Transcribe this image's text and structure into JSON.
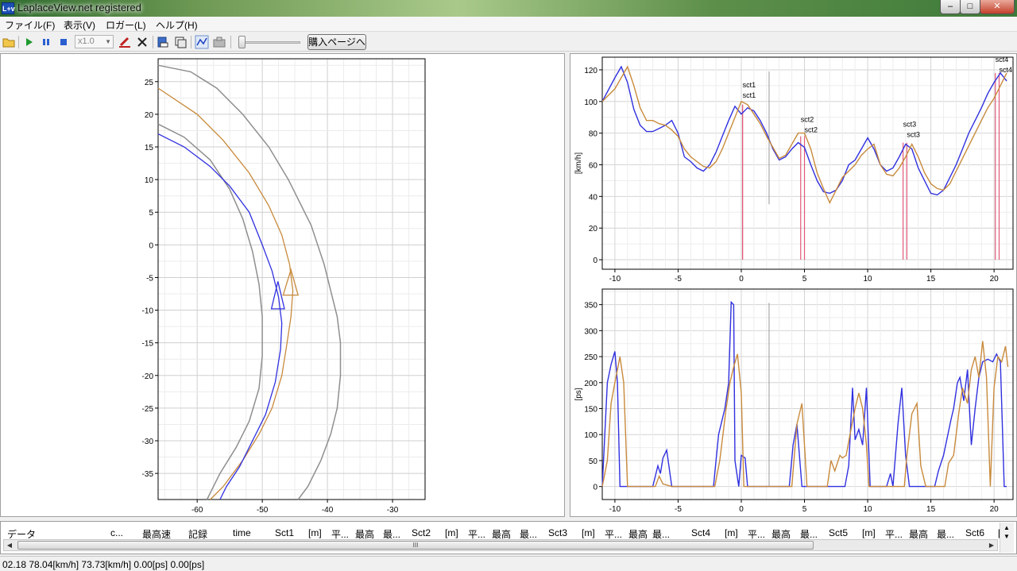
{
  "window": {
    "title": "LaplaceView.net registered",
    "icon_label": "L+v",
    "controls": {
      "minimize": "–",
      "maximize": "□",
      "close": "✕"
    }
  },
  "menu": [
    "ファイル(F)",
    "表示(V)",
    "ロガー(L)",
    "ヘルプ(H)"
  ],
  "toolbar": {
    "speed": "x1.0",
    "buy_button": "購入ページへ"
  },
  "map": {
    "x_ticks": [
      "-60",
      "-50",
      "-40",
      "-30"
    ],
    "y_ticks": [
      "25",
      "20",
      "15",
      "10",
      "5",
      "0",
      "-5",
      "-10",
      "-15",
      "-20",
      "-25",
      "-30",
      "-35"
    ]
  },
  "chart_data": [
    {
      "type": "line",
      "ylabel": "[km/h]",
      "xlim": [
        -11,
        21.5
      ],
      "ylim": [
        -6,
        128
      ],
      "x_ticks": [
        -10,
        -5,
        0,
        5,
        10,
        15,
        20
      ],
      "y_ticks": [
        0,
        20,
        40,
        60,
        80,
        100,
        120
      ],
      "cursor_x": 2.2,
      "series": [
        {
          "color": "#3030e0",
          "x": [
            -11,
            -10,
            -9.5,
            -9,
            -8.5,
            -8,
            -7.5,
            -7,
            -6.5,
            -6,
            -5.5,
            -5,
            -4.5,
            -4,
            -3.5,
            -3,
            -2.5,
            -2,
            -1.5,
            -1,
            -0.5,
            0,
            0.5,
            1,
            1.5,
            2,
            2.5,
            3,
            3.5,
            4,
            4.5,
            5,
            5.5,
            6,
            6.5,
            7,
            7.5,
            8,
            8.5,
            9,
            9.5,
            10,
            10.5,
            11,
            11.5,
            12,
            12.5,
            13,
            13.5,
            14,
            14.5,
            15,
            15.5,
            16,
            16.5,
            17,
            17.5,
            18,
            18.5,
            19,
            19.5,
            20,
            20.5,
            21
          ],
          "values": [
            100,
            115,
            122,
            112,
            95,
            85,
            81,
            81,
            83,
            85,
            88,
            80,
            65,
            62,
            58,
            56,
            60,
            68,
            78,
            88,
            97,
            92,
            96,
            94,
            88,
            80,
            70,
            63,
            65,
            70,
            74,
            71,
            60,
            50,
            43,
            42,
            44,
            50,
            60,
            63,
            70,
            77,
            70,
            60,
            56,
            58,
            65,
            73,
            70,
            58,
            50,
            42,
            41,
            44,
            52,
            60,
            70,
            80,
            88,
            96,
            105,
            112,
            118,
            113
          ]
        },
        {
          "color": "#c88a3c",
          "x": [
            -11,
            -10,
            -9.5,
            -9,
            -8.5,
            -8,
            -7.5,
            -7,
            -6.5,
            -6,
            -5.5,
            -5,
            -4.5,
            -4,
            -3.5,
            -3,
            -2.5,
            -2,
            -1.5,
            -1,
            -0.5,
            0,
            0.5,
            1,
            1.5,
            2,
            2.5,
            3,
            3.5,
            4,
            4.5,
            5,
            5.5,
            6,
            6.5,
            7,
            7.5,
            8,
            8.5,
            9,
            9.5,
            10,
            10.5,
            11,
            11.5,
            12,
            12.5,
            13,
            13.5,
            14,
            14.5,
            15,
            15.5,
            16,
            16.5,
            17,
            17.5,
            18,
            18.5,
            19,
            19.5,
            20,
            20.5,
            21
          ],
          "values": [
            100,
            108,
            115,
            122,
            110,
            96,
            88,
            88,
            86,
            85,
            82,
            78,
            70,
            65,
            62,
            59,
            58,
            62,
            70,
            80,
            90,
            100,
            98,
            92,
            86,
            78,
            71,
            64,
            66,
            73,
            80,
            80,
            70,
            55,
            45,
            36,
            44,
            52,
            56,
            60,
            66,
            70,
            73,
            60,
            54,
            53,
            58,
            65,
            73,
            65,
            55,
            48,
            45,
            44,
            48,
            56,
            64,
            72,
            80,
            88,
            96,
            102,
            110,
            118
          ]
        }
      ],
      "sectors": [
        {
          "label": "sct1",
          "x": [
            0.1,
            0.1
          ]
        },
        {
          "label": "sct2",
          "x": [
            4.7,
            5.0
          ]
        },
        {
          "label": "sct3",
          "x": [
            12.8,
            13.1
          ]
        },
        {
          "label": "sct4",
          "x": [
            20.1,
            20.4
          ]
        }
      ]
    },
    {
      "type": "line",
      "ylabel": "[ps]",
      "xlim": [
        -11,
        21.5
      ],
      "ylim": [
        -25,
        380
      ],
      "x_ticks": [
        -10,
        -5,
        0,
        5,
        10,
        15,
        20
      ],
      "y_ticks": [
        0,
        50,
        100,
        150,
        200,
        250,
        300,
        350
      ],
      "cursor_x": 2.2,
      "series": [
        {
          "color": "#3030e0",
          "x": [
            -11,
            -10.6,
            -10.3,
            -10,
            -9.8,
            -9.6,
            -9.3,
            -8.5,
            -7.5,
            -7,
            -6.6,
            -6.4,
            -6.2,
            -5.9,
            -5.5,
            -4.6,
            -3.5,
            -2.7,
            -2.2,
            -1.8,
            -1.3,
            -1,
            -0.8,
            -0.6,
            -0.5,
            -0.2,
            0,
            0.3,
            0.5,
            1.2,
            2,
            3,
            3.8,
            4.1,
            4.4,
            4.8,
            5,
            5.2,
            5.6,
            6.2,
            6.6,
            7.2,
            7.6,
            8,
            8.2,
            8.5,
            8.8,
            9,
            9.3,
            9.6,
            9.9,
            10.2,
            10.5,
            11,
            11.5,
            11.8,
            12,
            12.4,
            12.7,
            13,
            13.3,
            13.6,
            14,
            14.6,
            15.3,
            15.6,
            16,
            16.3,
            16.6,
            16.8,
            17.1,
            17.3,
            17.6,
            17.9,
            18.2,
            18.5,
            18.8,
            19.1,
            19.5,
            19.9,
            20.2,
            20.5,
            20.8,
            21
          ],
          "values": [
            0,
            200,
            235,
            260,
            200,
            0,
            0,
            0,
            0,
            0,
            40,
            25,
            55,
            70,
            0,
            0,
            0,
            0,
            0,
            100,
            150,
            200,
            355,
            350,
            50,
            0,
            60,
            55,
            0,
            0,
            0,
            0,
            0,
            80,
            120,
            0,
            0,
            0,
            0,
            0,
            0,
            0,
            0,
            0,
            0,
            40,
            190,
            90,
            110,
            80,
            190,
            0,
            0,
            0,
            0,
            25,
            0,
            120,
            190,
            60,
            0,
            0,
            0,
            0,
            0,
            30,
            60,
            95,
            130,
            150,
            200,
            210,
            165,
            225,
            80,
            150,
            210,
            240,
            245,
            240,
            255,
            240,
            0,
            0
          ]
        },
        {
          "color": "#c88a3c",
          "x": [
            -11,
            -10.6,
            -10.3,
            -10,
            -9.6,
            -9.3,
            -9,
            -8.5,
            -7.5,
            -6.8,
            -6.5,
            -6.2,
            -5.5,
            -4.5,
            -3.5,
            -2.6,
            -2.1,
            -1.7,
            -1.2,
            -0.9,
            -0.6,
            -0.3,
            0,
            0.2,
            0.4,
            1.2,
            2,
            3,
            4,
            4.4,
            4.8,
            5.2,
            5.6,
            6.2,
            6.8,
            7.1,
            7.4,
            7.8,
            8,
            8.3,
            8.6,
            9,
            9.3,
            9.6,
            9.9,
            10.1,
            10.5,
            11,
            11.5,
            12,
            12.5,
            12.9,
            13.1,
            13.5,
            13.9,
            14.2,
            14.6,
            15.3,
            15.7,
            16.1,
            16.4,
            16.8,
            17.2,
            17.5,
            17.9,
            18.2,
            18.5,
            18.8,
            19.1,
            19.4,
            19.7,
            20,
            20.3,
            20.6,
            20.9,
            21.1
          ],
          "values": [
            0,
            50,
            160,
            200,
            250,
            200,
            0,
            0,
            0,
            0,
            20,
            5,
            0,
            0,
            0,
            0,
            0,
            50,
            150,
            200,
            230,
            255,
            180,
            0,
            0,
            0,
            0,
            0,
            0,
            120,
            160,
            0,
            0,
            0,
            0,
            50,
            30,
            60,
            55,
            60,
            100,
            150,
            180,
            150,
            80,
            0,
            0,
            0,
            0,
            0,
            0,
            0,
            60,
            140,
            160,
            40,
            0,
            0,
            0,
            0,
            45,
            60,
            140,
            190,
            160,
            225,
            250,
            210,
            280,
            210,
            0,
            190,
            250,
            240,
            270,
            230
          ]
        }
      ]
    }
  ],
  "table": {
    "columns": [
      "データ",
      "c...",
      "最高速",
      "記録",
      "time",
      "Sct1",
      "[m]",
      "平...",
      "最高",
      "最...",
      "Sct2",
      "[m]",
      "平...",
      "最高",
      "最...",
      "Sct3",
      "[m]",
      "平...",
      "最高",
      "最...",
      "Sct4",
      "[m]",
      "平...",
      "最高",
      "最...",
      "Sct5",
      "[m]",
      "平...",
      "最高",
      "最...",
      "Sct6",
      "["
    ],
    "scroll_grip": "III"
  },
  "status": {
    "text": "02.18  78.04[km/h]  73.73[km/h]   0.00[ps]  0.00[ps]"
  }
}
